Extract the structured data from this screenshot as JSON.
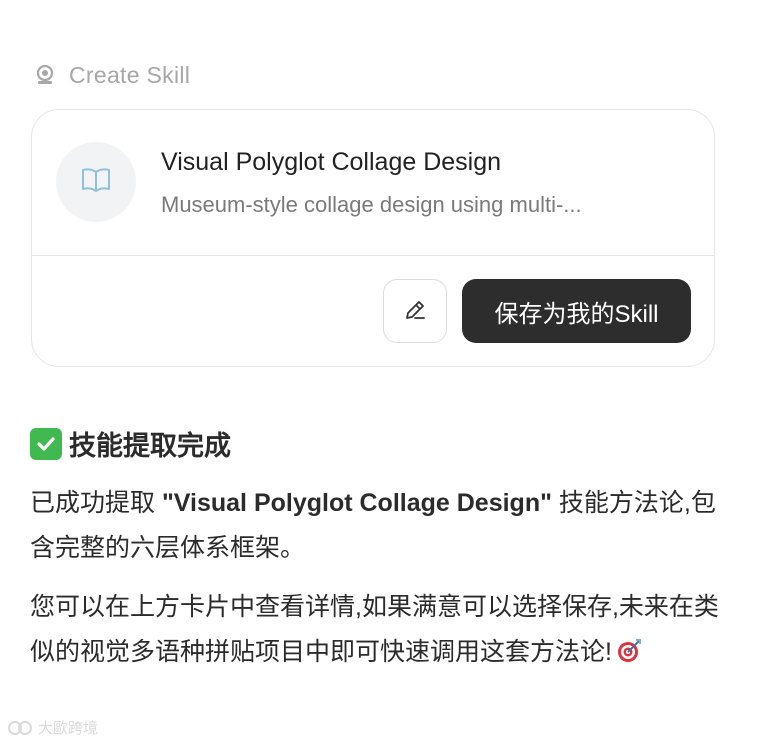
{
  "header": {
    "icon": "brain-icon",
    "label": "Create Skill"
  },
  "skill_card": {
    "icon": "book-icon",
    "title": "Visual Polyglot Collage Design",
    "description": "Museum-style collage design using multi-...",
    "edit_icon": "pencil-icon",
    "save_label": "保存为我的Skill"
  },
  "message": {
    "done_icon": "check-mark-button-icon",
    "done_title": "技能提取完成",
    "para1_prefix": "已成功提取 ",
    "para1_name": "\"Visual Polyglot Collage Design\"",
    "para1_suffix": " 技能方法论,包含完整的六层体系框架。",
    "para2": "您可以在上方卡片中查看详情,如果满意可以选择保存,未来在类似的视觉多语种拼贴项目中即可快速调用这套方法论!",
    "para2_emoji": "direct-hit-icon"
  },
  "watermark": {
    "text": "大歐跨境"
  },
  "colors": {
    "save_button_bg": "#2d2d2d",
    "check_green": "#3fb950",
    "muted_text": "#a7a7a7",
    "border": "#e6e6e6"
  }
}
